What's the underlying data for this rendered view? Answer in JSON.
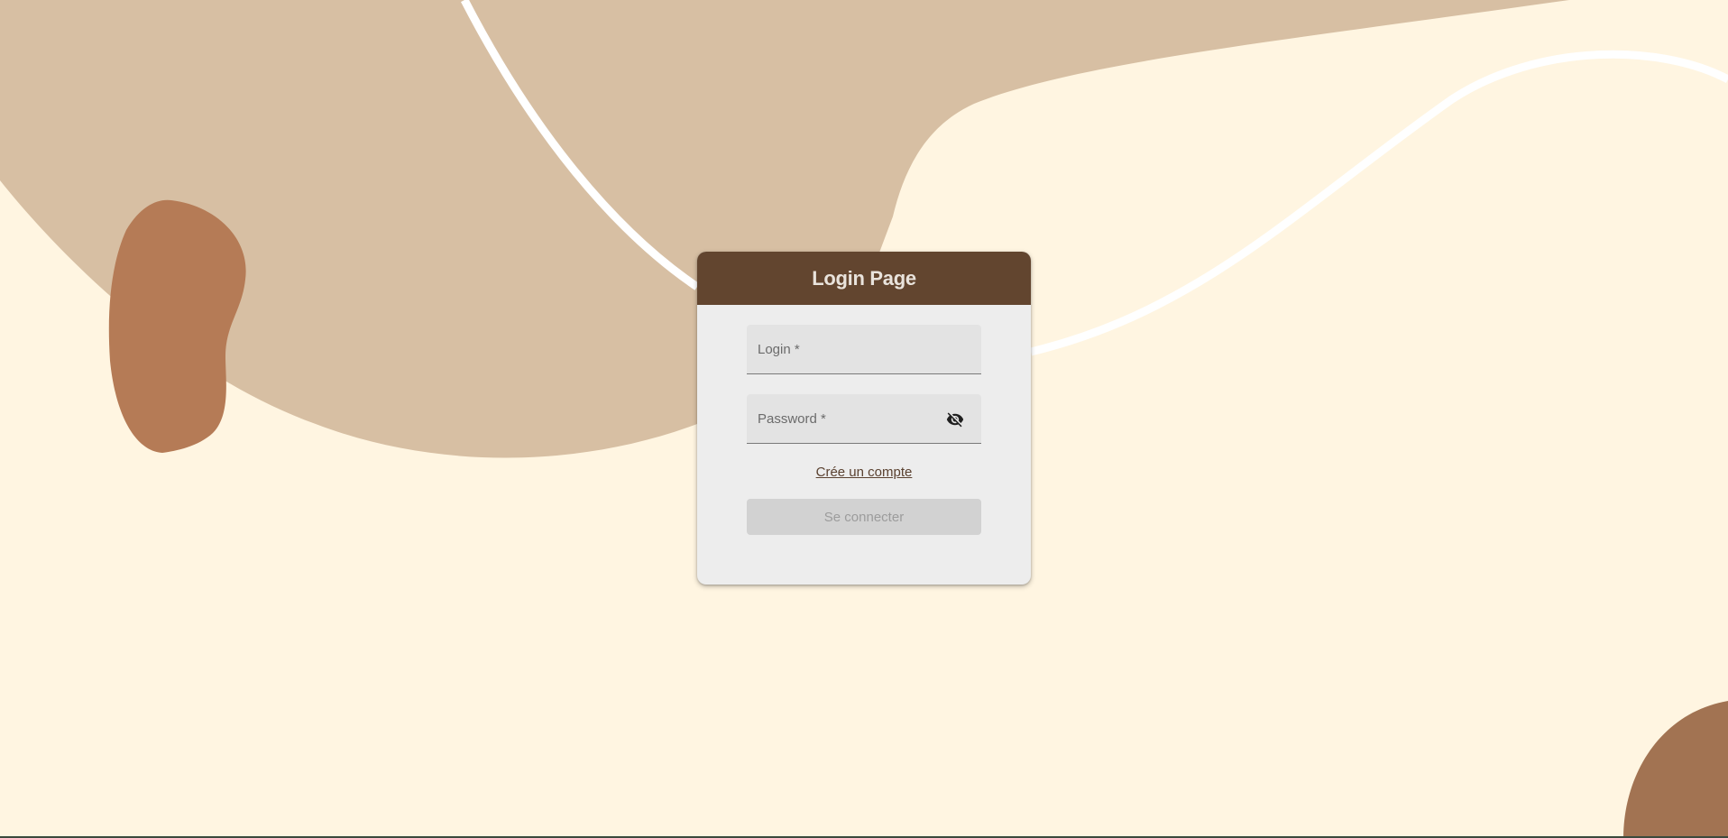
{
  "page": {
    "title": "Login Page"
  },
  "form": {
    "login_placeholder": "Login *",
    "password_placeholder": "Password *",
    "create_account_label": "Crée un compte",
    "submit_label": "Se connecter",
    "password_toggle_icon": "eye-off-icon"
  },
  "theme": {
    "background": "#fff5e1",
    "blob_light": "#d7bfa3",
    "blob_left": "#b57b56",
    "blob_corner": "#a27352",
    "header": "#62452f",
    "card": "#ededed"
  }
}
